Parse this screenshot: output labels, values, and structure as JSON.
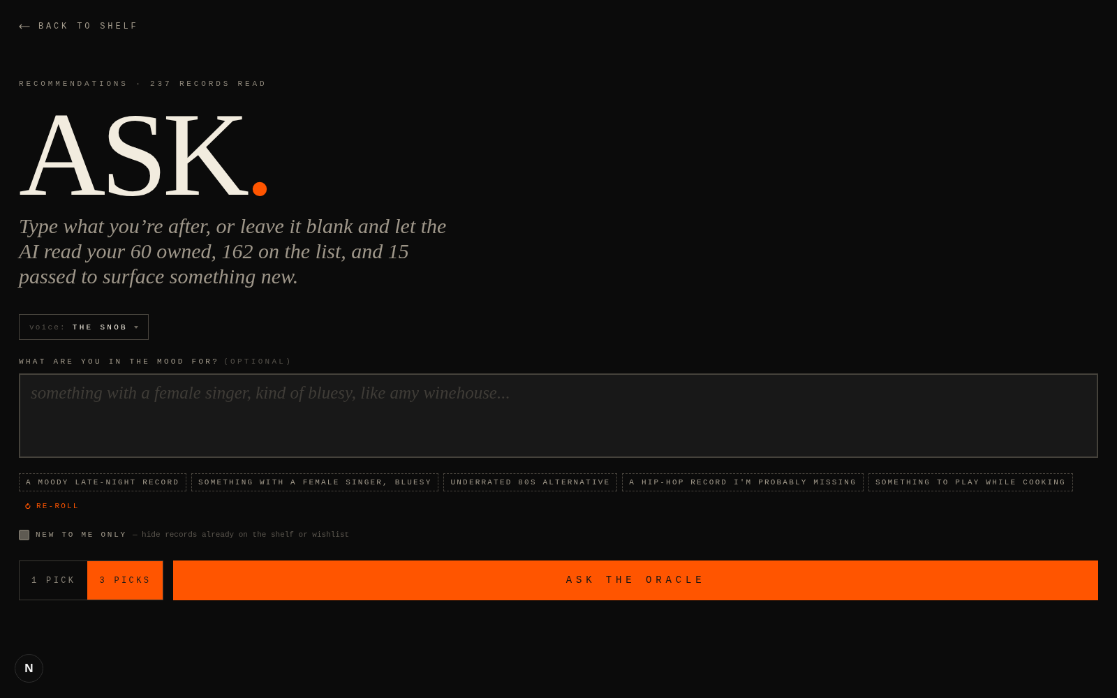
{
  "back_link": {
    "label": "BACK TO SHELF"
  },
  "eyebrow": "RECOMMENDATIONS · 237 RECORDS READ",
  "title": "ASK",
  "title_period": ".",
  "subtitle": "Type what you’re after, or leave it blank and let the AI read your 60 owned, 162 on the list, and 15 passed to surface something new.",
  "voice": {
    "label": "voice:",
    "value": "THE SNOB"
  },
  "mood": {
    "label": "WHAT ARE YOU IN THE MOOD FOR?",
    "hint": "(OPTIONAL)",
    "placeholder": "something with a female singer, kind of bluesy, like amy winehouse..."
  },
  "suggestions": [
    "A MOODY LATE-NIGHT RECORD",
    "SOMETHING WITH A FEMALE SINGER, BLUESY",
    "UNDERRATED 80S ALTERNATIVE",
    "A HIP-HOP RECORD I'M PROBABLY MISSING",
    "SOMETHING TO PLAY WHILE COOKING"
  ],
  "reroll": {
    "label": "RE-ROLL"
  },
  "new_only": {
    "label": "NEW TO ME ONLY",
    "note": "— hide records already on the shelf or wishlist",
    "checked": false
  },
  "pick_counts": [
    {
      "label": "1 PICK",
      "selected": false
    },
    {
      "label": "3 PICKS",
      "selected": true
    }
  ],
  "submit": {
    "label": "ASK THE ORACLE"
  },
  "dev_badge": {
    "label": "N"
  }
}
